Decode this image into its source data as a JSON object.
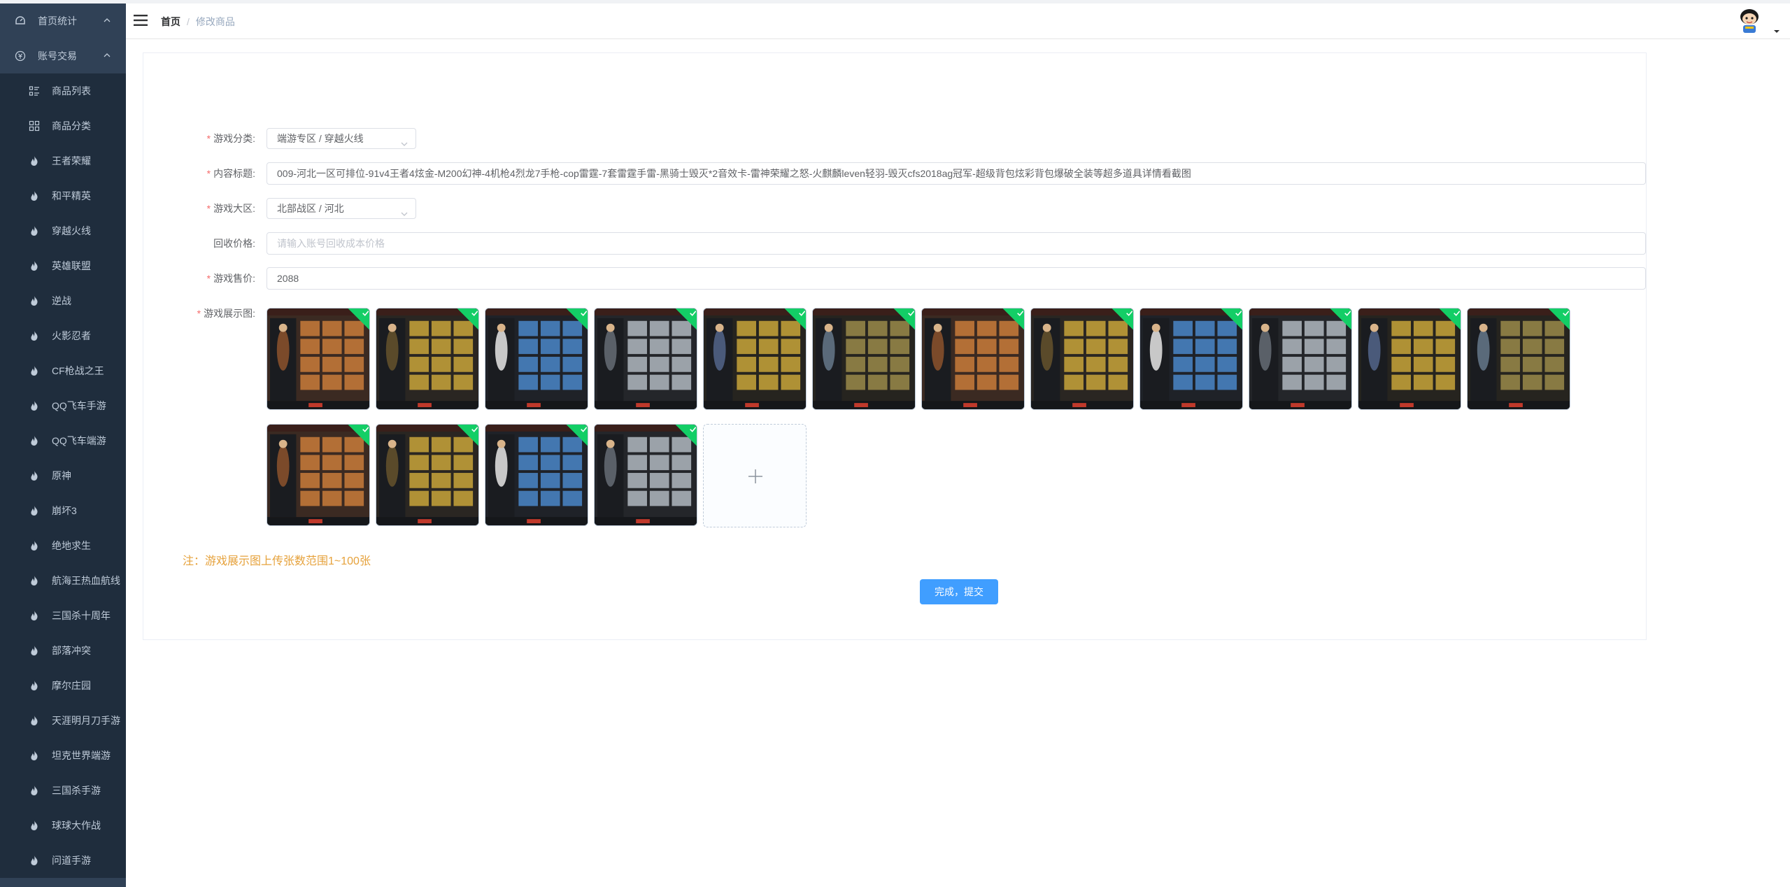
{
  "sidebar": {
    "items": [
      {
        "label": "首页统计",
        "icon": "dashboard-icon",
        "level": "top",
        "arrow": true
      },
      {
        "label": "账号交易",
        "icon": "currency-icon",
        "level": "top",
        "arrow": true
      },
      {
        "label": "商品列表",
        "icon": "list-icon",
        "level": "sub"
      },
      {
        "label": "商品分类",
        "icon": "grid-icon",
        "level": "sub"
      },
      {
        "label": "王者荣耀",
        "icon": "fire-icon",
        "level": "sub"
      },
      {
        "label": "和平精英",
        "icon": "fire-icon",
        "level": "sub"
      },
      {
        "label": "穿越火线",
        "icon": "fire-icon",
        "level": "sub"
      },
      {
        "label": "英雄联盟",
        "icon": "fire-icon",
        "level": "sub"
      },
      {
        "label": "逆战",
        "icon": "fire-icon",
        "level": "sub"
      },
      {
        "label": "火影忍者",
        "icon": "fire-icon",
        "level": "sub"
      },
      {
        "label": "CF枪战之王",
        "icon": "fire-icon",
        "level": "sub"
      },
      {
        "label": "QQ飞车手游",
        "icon": "fire-icon",
        "level": "sub"
      },
      {
        "label": "QQ飞车端游",
        "icon": "fire-icon",
        "level": "sub"
      },
      {
        "label": "原神",
        "icon": "fire-icon",
        "level": "sub"
      },
      {
        "label": "崩坏3",
        "icon": "fire-icon",
        "level": "sub"
      },
      {
        "label": "绝地求生",
        "icon": "fire-icon",
        "level": "sub"
      },
      {
        "label": "航海王热血航线",
        "icon": "fire-icon",
        "level": "sub"
      },
      {
        "label": "三国杀十周年",
        "icon": "fire-icon",
        "level": "sub"
      },
      {
        "label": "部落冲突",
        "icon": "fire-icon",
        "level": "sub"
      },
      {
        "label": "摩尔庄园",
        "icon": "fire-icon",
        "level": "sub"
      },
      {
        "label": "天涯明月刀手游",
        "icon": "fire-icon",
        "level": "sub"
      },
      {
        "label": "坦克世界端游",
        "icon": "fire-icon",
        "level": "sub"
      },
      {
        "label": "三国杀手游",
        "icon": "fire-icon",
        "level": "sub"
      },
      {
        "label": "球球大作战",
        "icon": "fire-icon",
        "level": "sub"
      },
      {
        "label": "问道手游",
        "icon": "fire-icon",
        "level": "sub"
      }
    ]
  },
  "header": {
    "breadcrumb_home": "首页",
    "breadcrumb_sep": "/",
    "breadcrumb_current": "修改商品"
  },
  "form": {
    "category": {
      "label": "游戏分类:",
      "value": "端游专区 / 穿越火线",
      "required": true
    },
    "title": {
      "label": "内容标题:",
      "value": "009-河北一区可排位-91v4王者4炫金-M200幻神-4机枪4烈龙7手枪-cop雷霆-7套雷霆手雷-黑骑士毁灭*2音效卡-雷神荣耀之怒-火麒麟leven轻羽-毁灭cfs2018ag冠军-超级背包炫彩背包爆破全装等超多道具详情看截图",
      "required": true
    },
    "region": {
      "label": "游戏大区:",
      "value": "北部战区 / 河北",
      "required": true
    },
    "recycle_price": {
      "label": "回收价格:",
      "placeholder": "请输入账号回收成本价格",
      "required": false
    },
    "price": {
      "label": "游戏售价:",
      "value": "2088",
      "required": true
    },
    "images": {
      "label": "游戏展示图:",
      "required": true,
      "count": 16
    }
  },
  "note": "注：游戏展示图上传张数范围1~100张",
  "submit_label": "完成，提交",
  "colors": {
    "sidebar_bg": "#304156",
    "submenu_bg": "#1f2d3d",
    "primary": "#409eff",
    "success": "#13ce66",
    "warning": "#e6a23c",
    "required": "#f56c6c"
  }
}
